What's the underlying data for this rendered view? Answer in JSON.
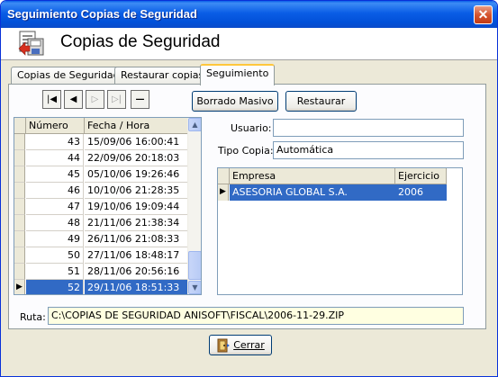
{
  "window": {
    "title": "Seguimiento Copias de Seguridad",
    "close_glyph": "✕"
  },
  "header": {
    "title": "Copias de Seguridad",
    "icon": "backup-icon"
  },
  "tabs": [
    {
      "label": "Copias de Seguridad"
    },
    {
      "label": "Restaurar copias"
    },
    {
      "label": "Seguimiento",
      "active": true
    }
  ],
  "nav": {
    "first": "|◀",
    "prev": "◀",
    "next": "▷",
    "last": "▷|",
    "delete": "—"
  },
  "buttons": {
    "borrado": "Borrado Masivo",
    "restaurar": "Restaurar",
    "cerrar": "Cerrar"
  },
  "grid": {
    "headers": {
      "numero": "Número",
      "fecha": "Fecha / Hora"
    },
    "rows": [
      {
        "num": "43",
        "fecha": "15/09/06 16:00:41"
      },
      {
        "num": "44",
        "fecha": "22/09/06 20:18:03"
      },
      {
        "num": "45",
        "fecha": "05/10/06 19:26:46"
      },
      {
        "num": "46",
        "fecha": "10/10/06 21:28:35"
      },
      {
        "num": "47",
        "fecha": "19/10/06 19:09:44"
      },
      {
        "num": "48",
        "fecha": "21/11/06 21:38:34"
      },
      {
        "num": "49",
        "fecha": "26/11/06 21:08:33"
      },
      {
        "num": "50",
        "fecha": "27/11/06 18:48:17"
      },
      {
        "num": "51",
        "fecha": "28/11/06 20:56:16"
      },
      {
        "num": "52",
        "fecha": "29/11/06 18:51:33"
      }
    ],
    "selected_indicator": "▶"
  },
  "form": {
    "usuario_label": "Usuario:",
    "usuario_value": "",
    "tipo_label": "Tipo Copia:",
    "tipo_value": "Automática",
    "ruta_label": "Ruta:",
    "ruta_value": "C:\\COPIAS DE SEGURIDAD ANISOFT\\FISCAL\\2006-11-29.ZIP"
  },
  "empresas": {
    "headers": {
      "empresa": "Empresa",
      "ejercicio": "Ejercicio"
    },
    "rows": [
      {
        "empresa": "ASESORIA GLOBAL S.A.",
        "ejercicio": "2006"
      }
    ]
  },
  "colors": {
    "selection": "#316ac5",
    "titlebar": "#0a5de6",
    "face": "#ece9d8"
  }
}
